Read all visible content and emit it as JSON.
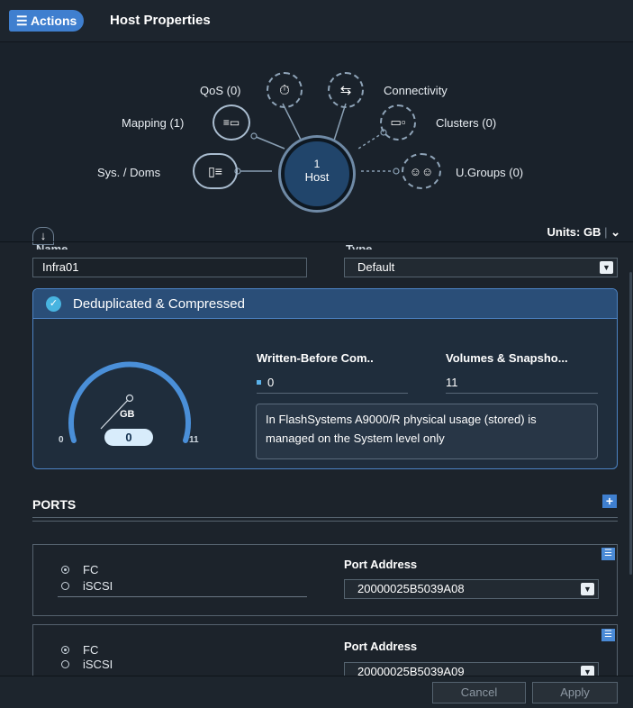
{
  "header": {
    "actions_label": "Actions",
    "title": "Host Properties"
  },
  "topology": {
    "host": {
      "count": "1",
      "label": "Host"
    },
    "qos": "QoS (0)",
    "connectivity": "Connectivity",
    "mapping": "Mapping (1)",
    "clusters": "Clusters (0)",
    "sys_doms": "Sys. / Doms",
    "ugroups": "U.Groups (0)",
    "units": "Units: GB"
  },
  "form": {
    "name_label": "Name",
    "name_value": "Infra01",
    "type_label": "Type",
    "type_value": "Default"
  },
  "dedup": {
    "title": "Deduplicated & Compressed",
    "gauge_unit": "GB",
    "gauge_value": "0",
    "gauge_min": "0",
    "gauge_max": "11",
    "gauge_level": 0,
    "written_label": "Written-Before Com..",
    "written_value": "0",
    "volumes_label": "Volumes & Snapsho...",
    "volumes_value": "11",
    "note": "In FlashSystems A9000/R physical usage (stored) is managed on the System level only"
  },
  "ports": {
    "title": "PORTS",
    "items": [
      {
        "protocol_fc": "FC",
        "protocol_iscsi": "iSCSI",
        "selected": "FC",
        "address_label": "Port Address",
        "address": "20000025B5039A08"
      },
      {
        "protocol_fc": "FC",
        "protocol_iscsi": "iSCSI",
        "selected": "FC",
        "address_label": "Port Address",
        "address": "20000025B5039A09"
      }
    ]
  },
  "footer": {
    "cancel": "Cancel",
    "apply": "Apply"
  },
  "colors": {
    "accent": "#3f7fcf",
    "card_border": "#4c83c4",
    "gauge": "#4a8fd8",
    "check": "#48b4e0"
  }
}
